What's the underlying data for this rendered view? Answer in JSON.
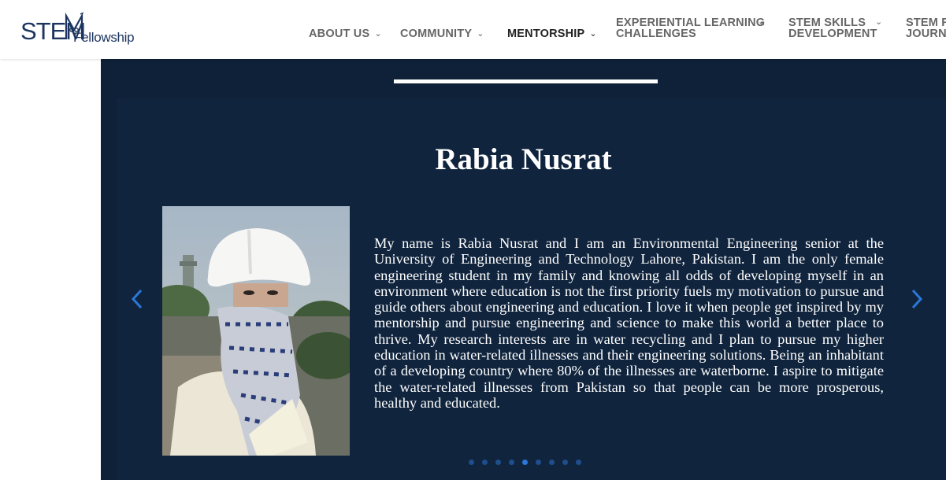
{
  "logo": {
    "stem_text": "STEM",
    "fellowship_text": "Fellowship"
  },
  "nav": {
    "items": [
      {
        "label": "ABOUT US"
      },
      {
        "label": "COMMUNITY"
      },
      {
        "label": "MENTORSHIP",
        "active": true
      },
      {
        "line1": "EXPERIENTIAL LEARNING",
        "line2": "CHALLENGES"
      },
      {
        "line1": "STEM SKILLS",
        "line2": "DEVELOPMENT"
      },
      {
        "line1": "STEM FI",
        "line2": "JOURNA"
      }
    ]
  },
  "slider": {
    "name": "Rabia Nusrat",
    "bio": "My name is Rabia Nusrat and I am an Environmental Engineering senior at the University of Engineering and Technology Lahore, Pakistan. I am the only female engineering student in my family and knowing all odds of developing myself in an environment where education is not the first priority fuels my motivation to pursue and guide others about engineering and education. I love it when people get inspired by my mentorship and pursue engineering and science to make this world a better place to thrive. My research interests are in water recycling and I plan to pursue my higher education in water-related illnesses and their engineering solutions. Being an inhabitant of a developing country where 80% of the illnesses are waterborne. I aspire to mitigate the water-related illnesses from Pakistan so that people can be more prosperous, healthy and educated.",
    "prev_icon": "chevron-left-icon",
    "next_icon": "chevron-right-icon",
    "dot_count": 9,
    "active_dot": 5
  },
  "colors": {
    "brand": "#1c3560",
    "slider_bg": "#0f2138",
    "arrow": "#2b78d9",
    "dot": "#1e4f8c",
    "dot_active": "#2b78d9"
  }
}
